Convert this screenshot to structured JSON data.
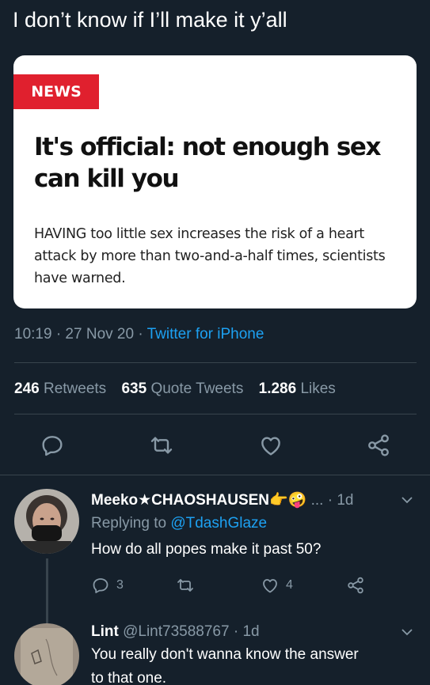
{
  "tweet": {
    "text": "I don’t know if I’ll make it y’all",
    "meta_time": "10:19 · 27 Nov 20 · ",
    "meta_source": "Twitter for iPhone",
    "stats": [
      {
        "count": "246",
        "label": "Retweets"
      },
      {
        "count": "635",
        "label": "Quote Tweets"
      },
      {
        "count": "1.286",
        "label": "Likes"
      }
    ],
    "actions": [
      "reply-icon",
      "retweet-icon",
      "like-icon",
      "share-icon"
    ]
  },
  "card": {
    "badge": "NEWS",
    "headline": "It's official: not enough sex can kill you",
    "summary": "HAVING too little sex increases the risk of a heart attack by more than two-and-a-half times, scientists have warned."
  },
  "replies": [
    {
      "name": "Meeko★CHAOSHAUSEN",
      "emoji": "👉🤪",
      "handle_suffix": " ... · 1d",
      "replying_prefix": "Replying to ",
      "replying_to": "@TdashGlaze",
      "text": "How do all popes make it past 50?",
      "reply_count": "3",
      "like_count": "4"
    },
    {
      "name": "Lint",
      "handle_suffix": " @Lint73588767 · 1d",
      "text_line1": "You really don't wanna know the answer",
      "text_line2": "to that one."
    }
  ],
  "colors": {
    "background": "#15202b",
    "accent": "#1da1f2",
    "muted": "#8899a6",
    "divider": "#38444d",
    "badge": "#e0202e"
  }
}
